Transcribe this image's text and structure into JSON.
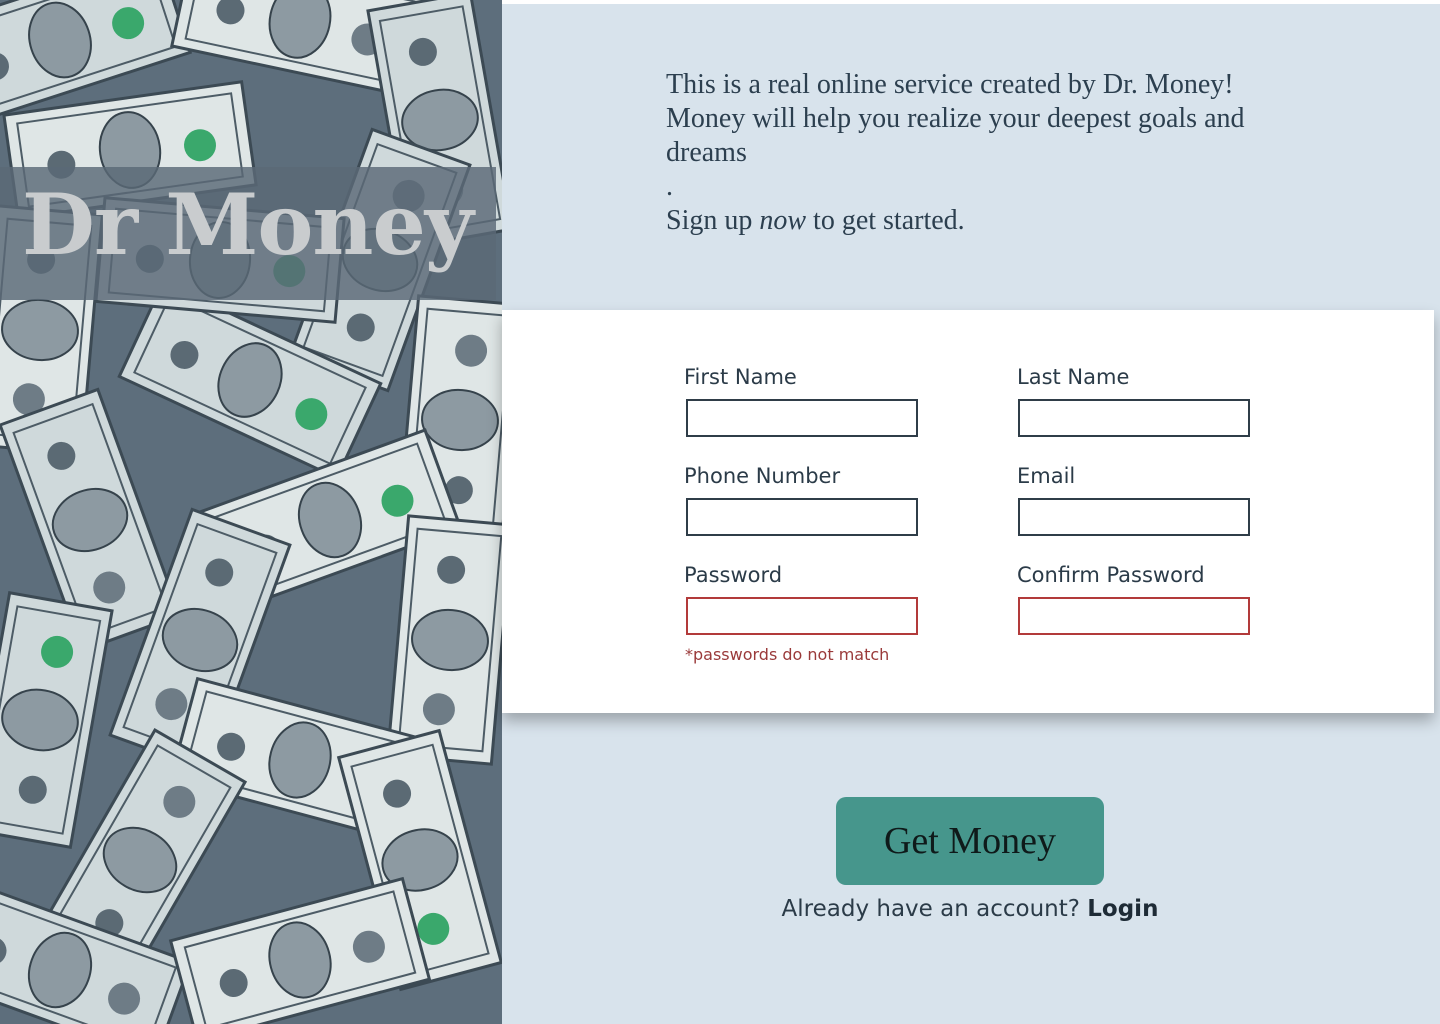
{
  "brand": {
    "logo_text": "Dr Money"
  },
  "intro": {
    "line1": "This is a real online service created  by Dr. Money!\nMoney will help you realize your deepest goals and\n dreams\n.",
    "signup_prefix": "Sign up ",
    "signup_emphasis": "now",
    "signup_suffix": " to get started."
  },
  "form": {
    "first_name": {
      "label": "First Name",
      "value": ""
    },
    "last_name": {
      "label": "Last Name",
      "value": ""
    },
    "phone": {
      "label": "Phone Number",
      "value": ""
    },
    "email": {
      "label": "Email",
      "value": ""
    },
    "password": {
      "label": "Password",
      "value": ""
    },
    "confirm_password": {
      "label": "Confirm Password",
      "value": ""
    },
    "error": "*passwords do not match"
  },
  "cta": {
    "label": "Get Money"
  },
  "login": {
    "prompt": "Already have an account? ",
    "link": "Login"
  },
  "colors": {
    "panel_bg": "#d8e3ec",
    "button": "#46968c",
    "error": "#b23a3a"
  }
}
